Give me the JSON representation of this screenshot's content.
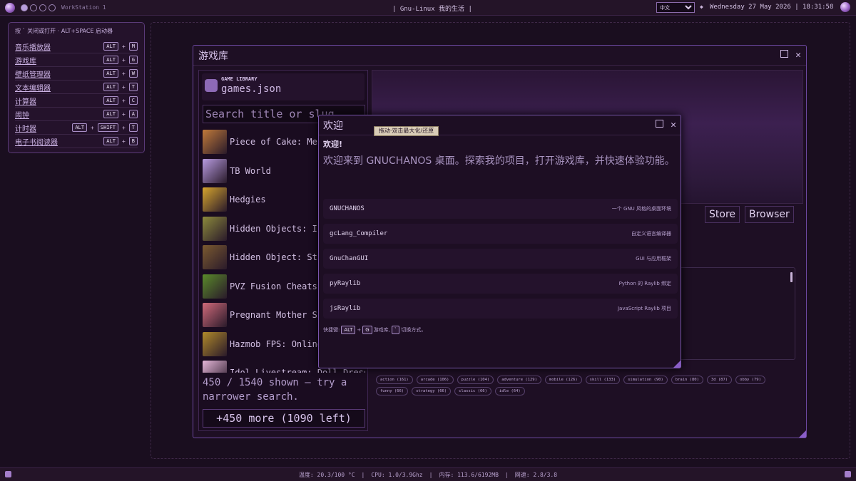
{
  "topbar": {
    "workstation": "WorkStation 1",
    "center_title": "| Gnu-Linux 我的生活 |",
    "language_selected": "中文",
    "datetime": "Wednesday 27 May 2026 | 18:31:58"
  },
  "launcher": {
    "header": "按 ` 关闭或打开 · ALT+SPACE 启动器",
    "items": [
      {
        "name": "音乐播放器",
        "keys": [
          "ALT",
          "M"
        ]
      },
      {
        "name": "游戏库",
        "keys": [
          "ALT",
          "G"
        ]
      },
      {
        "name": "壁纸管理器",
        "keys": [
          "ALT",
          "W"
        ]
      },
      {
        "name": "文本编辑器",
        "keys": [
          "ALT",
          "T"
        ]
      },
      {
        "name": "计算器",
        "keys": [
          "ALT",
          "C"
        ]
      },
      {
        "name": "闹钟",
        "keys": [
          "ALT",
          "A"
        ]
      },
      {
        "name": "计时器",
        "keys": [
          "ALT",
          "SHIFT",
          "T"
        ]
      },
      {
        "name": "电子书阅读器",
        "keys": [
          "ALT",
          "B"
        ]
      }
    ],
    "plus": "+"
  },
  "game_window": {
    "title": "游戏库",
    "library_label": "GAME LIBRARY",
    "library_file": "games.json",
    "search_placeholder": "Search title or slug",
    "games": [
      {
        "name": "Piece of Cake: Merge and Bake",
        "thumb": "#c07a3a"
      },
      {
        "name": "TB World",
        "thumb": "#b79be0"
      },
      {
        "name": "Hedgies",
        "thumb": "#d6a52e"
      },
      {
        "name": "Hidden Objects: Island",
        "thumb": "#8c8a3c"
      },
      {
        "name": "Hidden Object: Stickers",
        "thumb": "#7b5a30"
      },
      {
        "name": "PVZ Fusion Cheats",
        "thumb": "#5a8a2a"
      },
      {
        "name": "Pregnant Mother Simulator",
        "thumb": "#d06a7a"
      },
      {
        "name": "Hazmob FPS: Online",
        "thumb": "#b08a2a"
      },
      {
        "name": "Idol Livestream: Doll Dress Up",
        "thumb": "#e4b6d8"
      }
    ],
    "shown_text": "450 / 1540 shown — try a narrower search.",
    "more_button": "+450 more (1090 left)",
    "store_button": "Store",
    "browser_button": "Browser",
    "tags": [
      "action (161)",
      "arcade (106)",
      "puzzle (104)",
      "adventure (129)",
      "mobile (126)",
      "skill (133)",
      "simulation (90)",
      "brain (80)",
      "3d (87)",
      "obby (79)",
      "funny (66)",
      "strategy (66)",
      "classic (66)",
      "idle (64)"
    ]
  },
  "welcome": {
    "title": "欢迎",
    "tooltip": "拖动·双击最大化/还原",
    "greeting": "欢迎!",
    "intro": "欢迎来到 GNUCHANOS 桌面。探索我的项目，打开游戏库，并快速体验功能。",
    "projects": [
      {
        "name": "GNUCHANOS",
        "desc": "一个 GNU 风格的桌面环境"
      },
      {
        "name": "gcLang_Compiler",
        "desc": "自定义语言编译器"
      },
      {
        "name": "GnuChanGUI",
        "desc": "GUI 与应用框架"
      },
      {
        "name": "pyRaylib",
        "desc": "Python 的 Raylib 绑定"
      },
      {
        "name": "jsRaylib",
        "desc": "JavaScript Raylib 项目"
      }
    ],
    "hint_prefix": "快捷键:",
    "hint_key1": "ALT",
    "hint_plus": "+",
    "hint_key2": "G",
    "hint_mid": "游戏库,",
    "hint_key3": "`",
    "hint_suffix": "切换方式。"
  },
  "statusbar": {
    "temp": "温度:  20.3/100 °C",
    "cpu": "CPU:  1.0/3.9Ghz",
    "mem": "内存:  113.6/6192MB",
    "net": "网速:  2.8/3.8"
  }
}
